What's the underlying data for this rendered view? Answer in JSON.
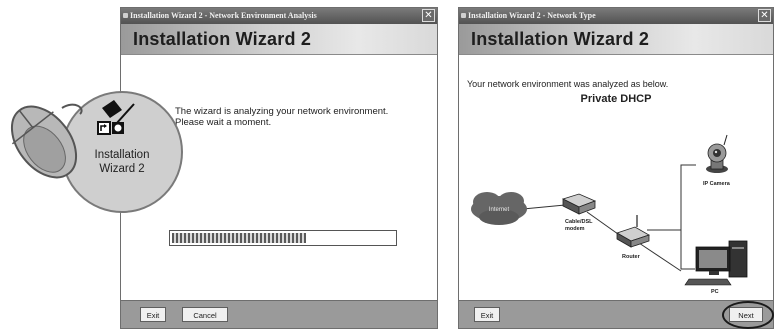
{
  "analysis_window": {
    "title": "Installation Wizard 2 - Network Environment Analysis",
    "close_glyph": "✕",
    "header": "Installation Wizard 2",
    "message_line1": "The wizard is analyzing your network environment.",
    "message_line2": "Please wait a moment.",
    "progress_fraction": 0.6,
    "buttons": {
      "exit": "Exit",
      "cancel": "Cancel"
    }
  },
  "type_window": {
    "title": "Installation Wizard 2 - Network Type",
    "close_glyph": "✕",
    "header": "Installation Wizard 2",
    "message": "Your network environment was analyzed as below.",
    "network_type": "Private DHCP",
    "diagram": {
      "internet": "Internet",
      "modem": "Cable/DSL modem",
      "router": "Router",
      "ip_camera": "IP Camera",
      "pc": "PC"
    },
    "buttons": {
      "exit": "Exit",
      "next": "Next"
    }
  },
  "callout": {
    "line1": "Installation",
    "line2": "Wizard 2",
    "icon": "mouse-icon"
  },
  "colors": {
    "window_bg": "#f2f2f2",
    "titlebar": "#5f5f5f",
    "footer": "#9a9a9a",
    "callout": "#cfcfcf"
  }
}
